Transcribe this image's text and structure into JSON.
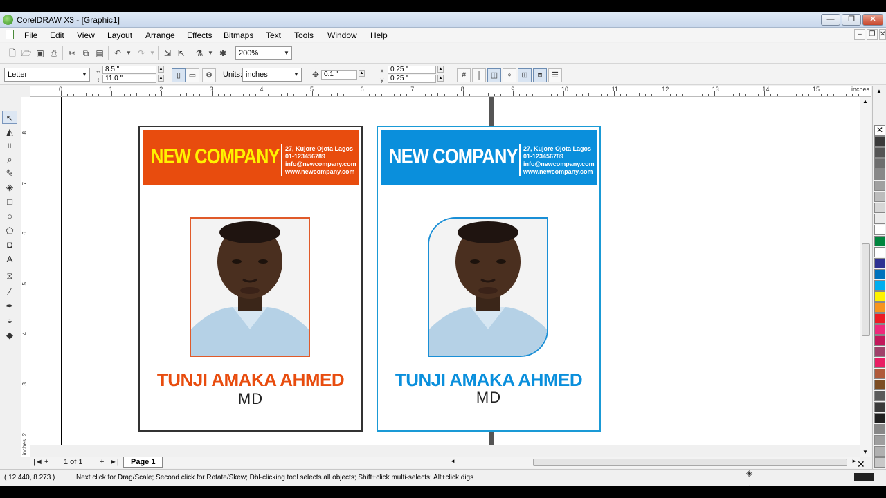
{
  "window": {
    "title": "CorelDRAW X3 - [Graphic1]",
    "minimize": "—",
    "maximize": "❐",
    "close": "✕"
  },
  "menu": [
    "File",
    "Edit",
    "View",
    "Layout",
    "Arrange",
    "Effects",
    "Bitmaps",
    "Text",
    "Tools",
    "Window",
    "Help"
  ],
  "standard_toolbar": {
    "zoom": "200%"
  },
  "property_bar": {
    "paper_type": "Letter",
    "width": "8.5 \"",
    "height": "11.0 \"",
    "units_label": "Units:",
    "units": "inches",
    "nudge": "0.1 \"",
    "dup_x": "0.25 \"",
    "dup_y": "0.25 \""
  },
  "rulers": {
    "horizontal_ticks": [
      "0",
      "1",
      "2",
      "3",
      "4",
      "5",
      "6",
      "7",
      "8",
      "9",
      "10",
      "11",
      "12",
      "13",
      "14",
      "15"
    ],
    "horizontal_unit": "inches",
    "vertical_ticks": [
      "8",
      "7",
      "6",
      "5",
      "4",
      "3",
      "2"
    ],
    "vertical_unit": "inches"
  },
  "cards": [
    {
      "company": "NEW COMPANY",
      "contact": [
        "27, Kujore Ojota Lagos",
        "01-123456789",
        "info@newcompany.com",
        "www.newcompany.com"
      ],
      "name": "TUNJI AMAKA AHMED",
      "role": "MD",
      "accent": "#e84c0e",
      "company_color": "#fff200",
      "border": "#333333"
    },
    {
      "company": "NEW COMPANY",
      "contact": [
        "27, Kujore Ojota Lagos",
        "01-123456789",
        "info@newcompany.com",
        "www.newcompany.com"
      ],
      "name": "TUNJI AMAKA AHMED",
      "role": "MD",
      "accent": "#0a8fdc",
      "company_color": "#ffffff",
      "border": "#1a9ad6"
    }
  ],
  "page_nav": {
    "counter": "1 of 1",
    "tab": "Page 1"
  },
  "status": {
    "coords": "( 12.440, 8.273 )",
    "hint": "Next click for Drag/Scale; Second click for Rotate/Skew; Dbl-clicking tool selects all objects; Shift+click multi-selects; Alt+click digs"
  },
  "palette": [
    "#3a3a3a",
    "#555555",
    "#6e6e6e",
    "#888888",
    "#a0a0a0",
    "#bcbcbc",
    "#d6d6d6",
    "#ebebeb",
    "#ffffff",
    "#00853e",
    "#ffffff",
    "#2e3192",
    "#0072bc",
    "#00aeef",
    "#fff200",
    "#f7941d",
    "#ed1c24",
    "#ee2a7b",
    "#c2185b",
    "#a0416a",
    "#e91e63",
    "#b05a3a",
    "#7d4e24",
    "#5a5a5a",
    "#3a3a3a",
    "#1f1f1f",
    "#888888",
    "#9e9e9e",
    "#b0b0b0",
    "#c8c8c8"
  ]
}
